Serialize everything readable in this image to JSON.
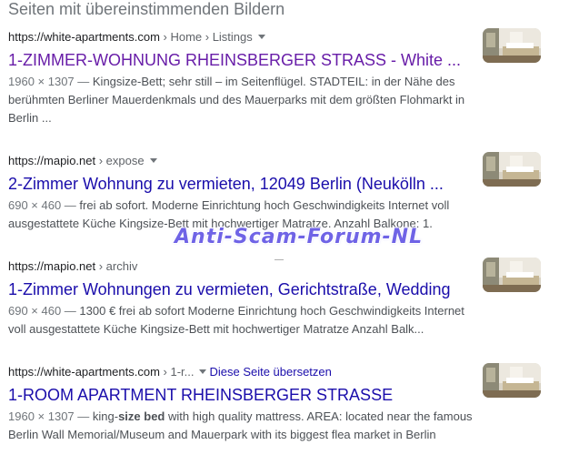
{
  "heading": "Seiten mit übereinstimmenden Bildern",
  "results": [
    {
      "cite_domain": "https://white-apartments.com",
      "cite_path": " › Home › Listings",
      "title": "1-ZIMMER-WOHNUNG RHEINSBERGER STRASS - White ...",
      "snippet_meta": "1960 × 1307 — ",
      "snippet_text": "Kingsize-Bett; sehr still – im Seitenflügel. STADTEIL: in der Nähe des berühmten Berliner Mauerdenkmals und des Mauerparks mit dem größten Flohmarkt in Berlin ..."
    },
    {
      "cite_domain": "https://mapio.net",
      "cite_path": " › expose",
      "title": "2-Zimmer Wohnung zu vermieten, 12049 Berlin (Neukölln ...",
      "snippet_meta": "690 × 460 — ",
      "snippet_text": "frei ab sofort. Moderne Einrichtung hoch Geschwindigkeits Internet voll ausgestattete Küche Kingsize-Bett mit hochwertiger Matratze. Anzahl Balkone: 1."
    },
    {
      "cite_domain": "https://mapio.net",
      "cite_path": " › archiv",
      "title": "1-Zimmer Wohnungen zu vermieten, Gerichtstraße, Wedding",
      "snippet_meta": "690 × 460 — ",
      "snippet_text": "1300 € frei ab sofort Moderne Einrichtung hoch Geschwindigkeits Internet voll ausgestattete Küche Kingsize-Bett mit hochwertiger Matratze Anzahl Balk..."
    },
    {
      "cite_domain": "https://white-apartments.com",
      "cite_path": " › 1-r...",
      "translate_label": "Diese Seite übersetzen",
      "title": "1-ROOM APARTMENT RHEINSBERGER STRASSE",
      "snippet_meta": "1960 × 1307 — ",
      "snippet_pre": "king-",
      "snippet_bold": "size bed",
      "snippet_post": " with high quality mattress. AREA: located near the famous Berlin Wall Memorial/Museum and Mauerpark with its biggest flea market in Berlin"
    }
  ],
  "watermark": "Anti-Scam-Forum-NL",
  "colors": {
    "link": "#1a0dab",
    "visited": "#681da8",
    "watermark": "#6f63e6"
  }
}
